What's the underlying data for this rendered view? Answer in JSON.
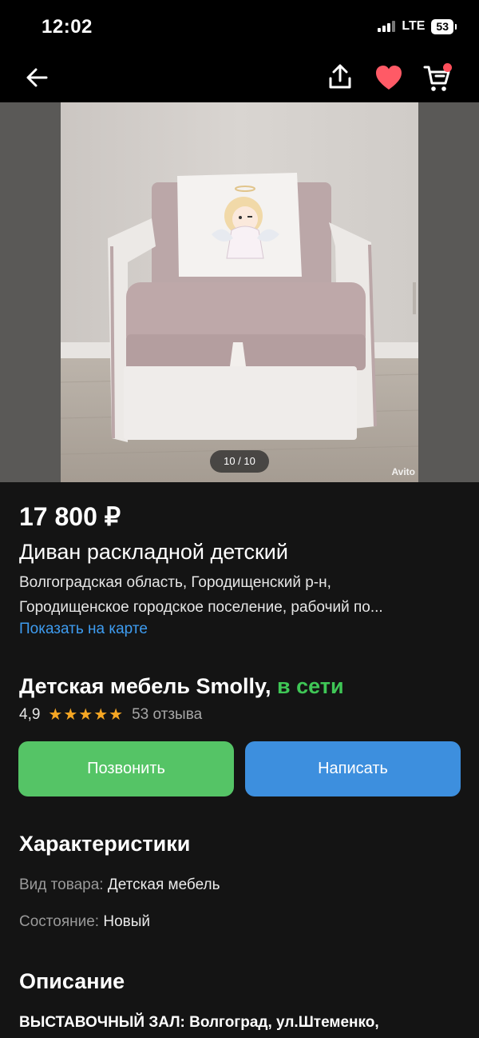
{
  "status_bar": {
    "time": "12:02",
    "network": "LTE",
    "battery": "53"
  },
  "gallery": {
    "counter": "10 / 10",
    "watermark": "Avito"
  },
  "listing": {
    "price": "17 800 ₽",
    "title": "Диван раскладной детский",
    "address_line1": "Волгоградская область, Городищенский р-н,",
    "address_line2": "Городищенское городское поселение, рабочий по...",
    "map_link": "Показать на карте"
  },
  "seller": {
    "name": "Детская мебель Smolly,",
    "online": "в сети",
    "rating": "4,9",
    "stars": "★★★★★",
    "stars_value": 5,
    "reviews": "53 отзыва"
  },
  "actions": {
    "call": "Позвонить",
    "message": "Написать"
  },
  "characteristics": {
    "title": "Характеристики",
    "rows": [
      {
        "key": "Вид товара:",
        "value": "Детская мебель"
      },
      {
        "key": "Состояние:",
        "value": "Новый"
      }
    ]
  },
  "description": {
    "title": "Описание",
    "first_line": "ВЫСТАВОЧНЫЙ ЗАЛ: Волгоград, ул.Штеменко,"
  },
  "colors": {
    "accent_green": "#55c466",
    "accent_blue": "#3d8fde",
    "link": "#3e9cf0",
    "online": "#3fc756",
    "star": "#f5a623",
    "cart_badge": "#ff4f5b"
  }
}
